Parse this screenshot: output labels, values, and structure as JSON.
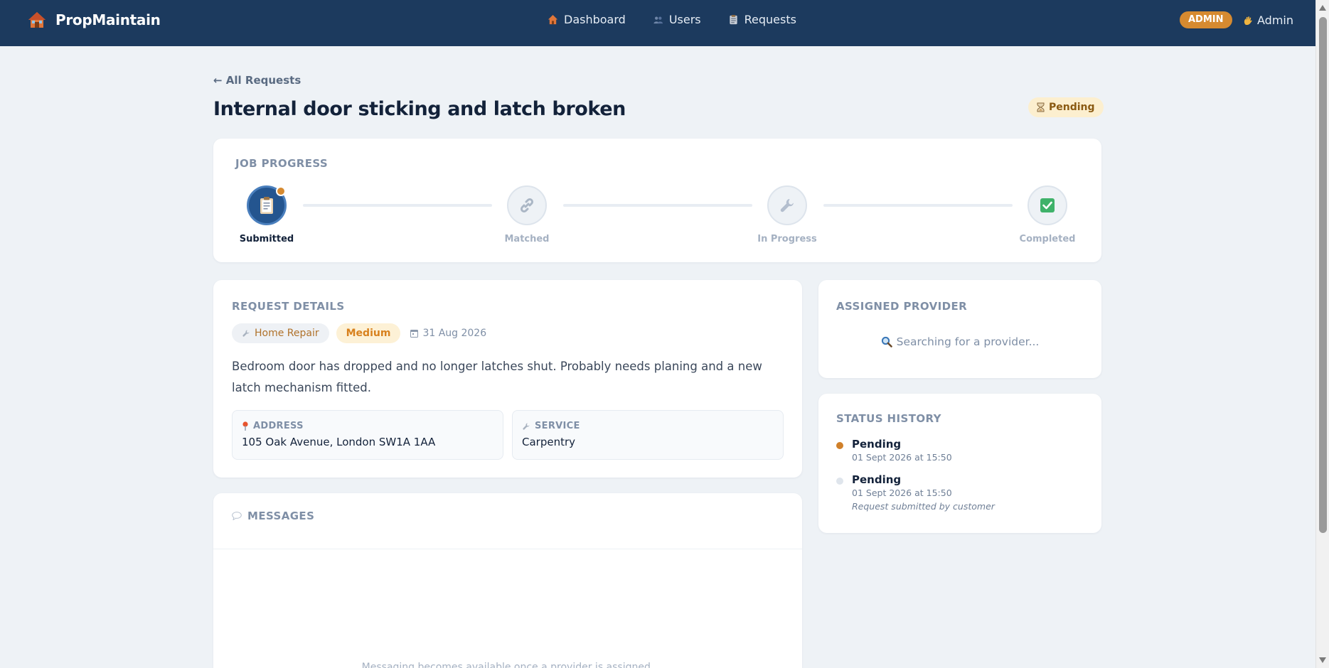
{
  "app": {
    "brand": "PropMaintain",
    "nav": [
      {
        "label": "Dashboard",
        "icon": "house-icon"
      },
      {
        "label": "Users",
        "icon": "users-icon"
      },
      {
        "label": "Requests",
        "icon": "clipboard-icon"
      }
    ],
    "role_badge": "ADMIN",
    "user_name": "Admin"
  },
  "header": {
    "back_link": "← All Requests",
    "title": "Internal door sticking and latch broken",
    "status": "Pending",
    "status_icon": "hourglass-icon"
  },
  "progress": {
    "title": "JOB PROGRESS",
    "steps": [
      {
        "label": "Submitted",
        "active": true,
        "icon": "clipboard-icon"
      },
      {
        "label": "Matched",
        "active": false,
        "icon": "link-icon"
      },
      {
        "label": "In Progress",
        "active": false,
        "icon": "wrench-icon"
      },
      {
        "label": "Completed",
        "active": false,
        "icon": "checkmark-icon"
      }
    ]
  },
  "details": {
    "title": "REQUEST DETAILS",
    "category": "Home Repair",
    "priority": "Medium",
    "date": "31 Aug 2026",
    "description": "Bedroom door has dropped and no longer latches shut. Probably needs planing and a new latch mechanism fitted.",
    "address_label": "ADDRESS",
    "address_value": "105 Oak Avenue, London SW1A 1AA",
    "service_label": "SERVICE",
    "service_value": "Carpentry"
  },
  "messages": {
    "title": "MESSAGES",
    "empty_text": "Messaging becomes available once a provider is assigned."
  },
  "provider": {
    "title": "ASSIGNED PROVIDER",
    "searching": "Searching for a provider..."
  },
  "history": {
    "title": "STATUS HISTORY",
    "entries": [
      {
        "status": "Pending",
        "time": "01 Sept 2026 at 15:50",
        "note": "",
        "dot_color": "#d0802a"
      },
      {
        "status": "Pending",
        "time": "01 Sept 2026 at 15:50",
        "note": "Request submitted by customer",
        "dot_color": "#dfe5ec"
      }
    ]
  },
  "colors": {
    "navbar": "#1c3a5e",
    "accent": "#d68a30",
    "active_step": "#24558f",
    "background": "#eef2f6"
  }
}
